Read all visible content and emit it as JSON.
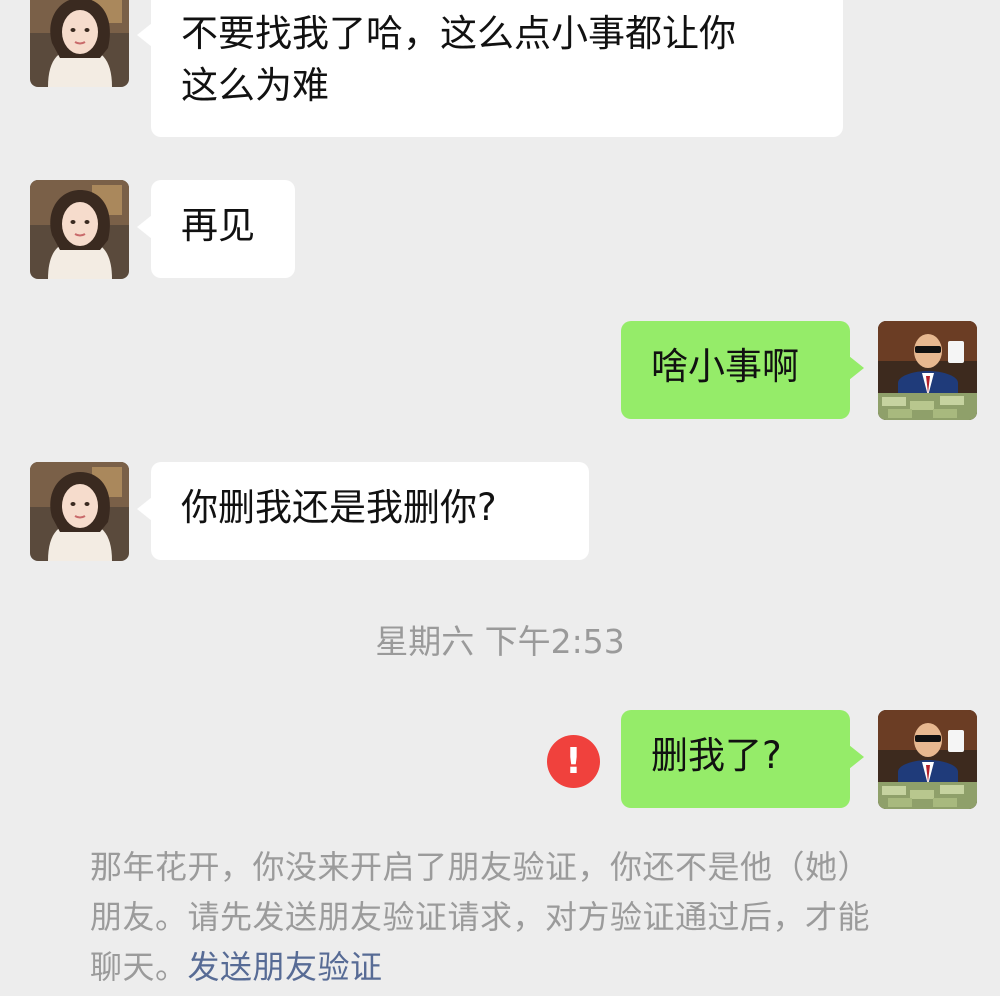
{
  "messages": [
    {
      "id": "m1",
      "side": "received",
      "avatar": "female-contact",
      "lines": [
        "不要找我了哈，这么点小事都让你",
        "这么为难"
      ]
    },
    {
      "id": "m2",
      "side": "received",
      "avatar": "female-contact",
      "lines": [
        "再见"
      ]
    },
    {
      "id": "m3",
      "side": "sent",
      "avatar": "self",
      "lines": [
        "啥小事啊"
      ]
    },
    {
      "id": "m4",
      "side": "received",
      "avatar": "female-contact",
      "lines": [
        "你删我还是我删你?"
      ]
    },
    {
      "id": "m5",
      "side": "sent",
      "avatar": "self",
      "lines": [
        "删我了?"
      ],
      "status": "send-failed"
    }
  ],
  "timestamp": "星期六 下午2:53",
  "error_icon": {
    "glyph": "!",
    "name": "exclamation-icon",
    "color": "#f0413d"
  },
  "system_notice": {
    "lines": [
      "那年花开，你没来开启了朋友验证，你还不是他（她）",
      "朋友。请先发送朋友验证请求，对方验证通过后，才能",
      "聊天。"
    ],
    "link_text": "发送朋友验证"
  },
  "colors": {
    "background": "#ededed",
    "bubble_received": "#ffffff",
    "bubble_sent": "#95ec69",
    "timestamp_text": "#9a9a9a",
    "notice_text": "#9b9b9b",
    "link": "#576b95",
    "error": "#f0413d"
  }
}
